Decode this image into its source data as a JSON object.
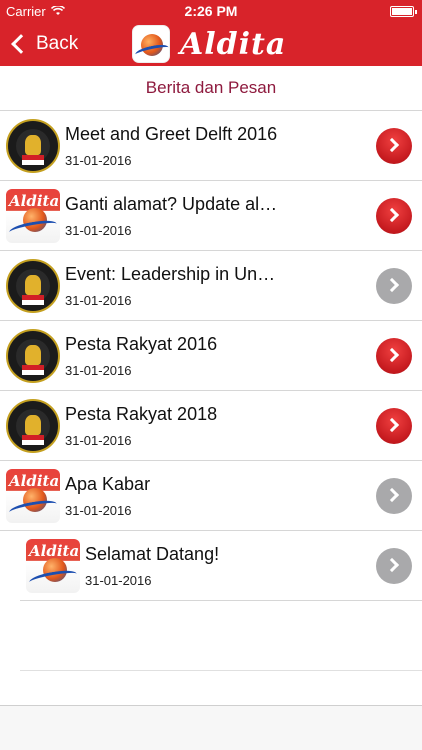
{
  "status_bar": {
    "carrier": "Carrier",
    "time": "2:26 PM"
  },
  "nav": {
    "back_label": "Back",
    "brand_name": "Aldita"
  },
  "section_title": "Berita dan Pesan",
  "colors": {
    "brand_red": "#d8232a",
    "section_title": "#8e1a3e",
    "chevron_active": "#c51a1f",
    "chevron_inactive": "#a9a9ab"
  },
  "items": [
    {
      "title": "Meet and Greet Delft 2016",
      "date": "31-01-2016",
      "icon": "garuda-emblem-icon",
      "unread": true
    },
    {
      "title": "Ganti alamat? Update al…",
      "date": "31-01-2016",
      "icon": "aldita-logo-icon",
      "unread": true
    },
    {
      "title": "Event: Leadership in Un…",
      "date": "31-01-2016",
      "icon": "garuda-emblem-icon",
      "unread": false
    },
    {
      "title": "Pesta Rakyat 2016",
      "date": "31-01-2016",
      "icon": "garuda-emblem-icon",
      "unread": true
    },
    {
      "title": "Pesta Rakyat 2018",
      "date": "31-01-2016",
      "icon": "garuda-emblem-icon",
      "unread": true
    },
    {
      "title": "Apa Kabar",
      "date": "31-01-2016",
      "icon": "aldita-logo-icon",
      "unread": false
    },
    {
      "title": "Selamat Datang!",
      "date": "31-01-2016",
      "icon": "aldita-logo-icon",
      "unread": false
    }
  ]
}
